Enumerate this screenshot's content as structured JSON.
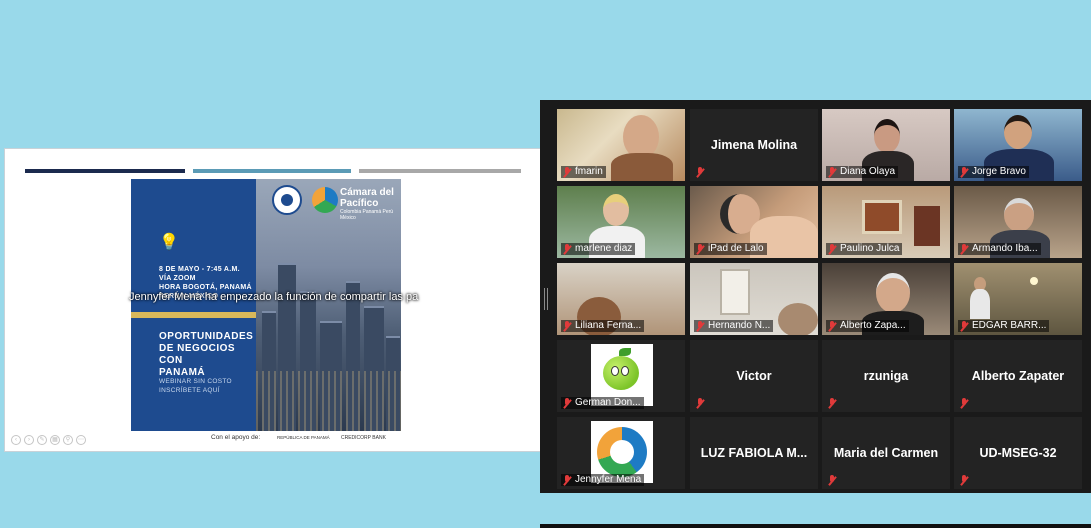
{
  "slide": {
    "flyer": {
      "event_lines": [
        "8 DE MAYO - 7:45 A.M.",
        "VÍA ZOOM",
        "HORA BOGOTÁ, PANAMÁ",
        "PERÚ Y MÉXICO"
      ],
      "headline_lines": [
        "OPORTUNIDADES",
        "DE NEGOCIOS CON",
        "PANAMÁ"
      ],
      "sub_lines": [
        "WEBINAR SIN COSTO",
        "INSCRÍBETE AQUÍ"
      ],
      "camara_name_lines": [
        "Cámara del",
        "Pacífico"
      ],
      "camara_tagline": "Colombia Panamá Perú México"
    },
    "share_banner": "Jennyfer Mena ha empezado la función de compartir las pa",
    "support_text": "Con el apoyo de:",
    "sponsor1": "REPÚBLICA DE PANAMÁ",
    "sponsor2": "CREDICORP BANK",
    "control_icons": [
      "previous-icon",
      "next-icon",
      "pen-icon",
      "grid-icon",
      "zoom-icon",
      "more-icon"
    ]
  },
  "gallery": {
    "active_border_color": "#a6d62b",
    "muted_icon": "mic-muted-icon",
    "participants": [
      {
        "name": "fmarin",
        "video": true,
        "active": true
      },
      {
        "name": "Jimena Molina",
        "video": false
      },
      {
        "name": "Diana Olaya",
        "video": true
      },
      {
        "name": "Jorge Bravo",
        "video": true
      },
      {
        "name": "marlene diaz",
        "video": true
      },
      {
        "name": "iPad de Lalo",
        "video": true
      },
      {
        "name": "Paulino Julca",
        "video": true
      },
      {
        "name": "Armando Iba...",
        "video": true
      },
      {
        "name": "Liliana Ferna...",
        "video": true
      },
      {
        "name": "Hernando N...",
        "video": true
      },
      {
        "name": "Alberto Zapa...",
        "video": true
      },
      {
        "name": "EDGAR BARR...",
        "video": true
      },
      {
        "name": "German Don...",
        "video": "avatar"
      },
      {
        "name": "Victor",
        "video": false
      },
      {
        "name": "rzuniga",
        "video": false
      },
      {
        "name": "Alberto Zapater",
        "video": false
      },
      {
        "name": "Jennyfer Mena",
        "video": "avatar"
      },
      {
        "name": "LUZ FABIOLA M...",
        "video": false
      },
      {
        "name": "Maria del Carmen",
        "video": false
      },
      {
        "name": "UD-MSEG-32",
        "video": false
      }
    ]
  }
}
